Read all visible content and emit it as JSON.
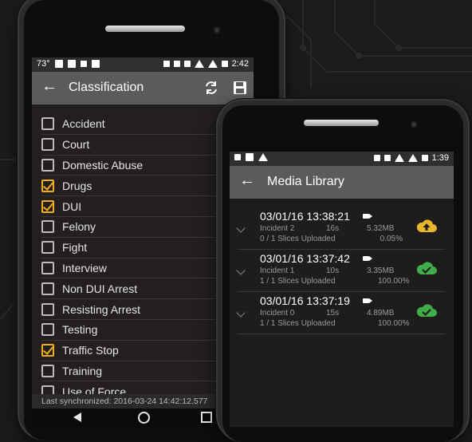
{
  "classification_screen": {
    "statusbar": {
      "temperature": "73°",
      "time": "2:42"
    },
    "title": "Classification",
    "items": [
      {
        "label": "Accident",
        "checked": false
      },
      {
        "label": "Court",
        "checked": false
      },
      {
        "label": "Domestic Abuse",
        "checked": false
      },
      {
        "label": "Drugs",
        "checked": true
      },
      {
        "label": "DUI",
        "checked": true
      },
      {
        "label": "Felony",
        "checked": false
      },
      {
        "label": "Fight",
        "checked": false
      },
      {
        "label": "Interview",
        "checked": false
      },
      {
        "label": "Non DUI Arrest",
        "checked": false
      },
      {
        "label": "Resisting Arrest",
        "checked": false
      },
      {
        "label": "Testing",
        "checked": false
      },
      {
        "label": "Traffic Stop",
        "checked": true
      },
      {
        "label": "Training",
        "checked": false
      },
      {
        "label": "Use of Force",
        "checked": false
      }
    ],
    "sync_text": "Last synchronized: 2016-03-24 14:42:12.577"
  },
  "media_screen": {
    "statusbar": {
      "time": "1:39"
    },
    "title": "Media Library",
    "items": [
      {
        "timestamp": "03/01/16 13:38:21",
        "incident": "Incident 2",
        "duration": "16s",
        "size": "5.32MB",
        "slices": "0 / 1 Slices Uploaded",
        "percent": "0.05%",
        "status": "uploading",
        "cloud_color": "#e7b62a"
      },
      {
        "timestamp": "03/01/16 13:37:42",
        "incident": "Incident 1",
        "duration": "10s",
        "size": "3.35MB",
        "slices": "1 / 1 Slices Uploaded",
        "percent": "100.00%",
        "status": "uploaded",
        "cloud_color": "#3fae49"
      },
      {
        "timestamp": "03/01/16 13:37:19",
        "incident": "Incident 0",
        "duration": "15s",
        "size": "4.89MB",
        "slices": "1 / 1 Slices Uploaded",
        "percent": "100.00%",
        "status": "uploaded",
        "cloud_color": "#3fae49"
      }
    ]
  },
  "colors": {
    "accent_checkbox": "#f0ad1e",
    "appbar": "#5b5b5b",
    "background": "#1b1b1b"
  },
  "icons": {
    "refresh": "refresh-icon",
    "save": "save-icon",
    "back": "back-arrow-icon",
    "video": "video-camera-icon",
    "cloud_upload": "cloud-upload-icon",
    "cloud_done": "cloud-check-icon"
  }
}
